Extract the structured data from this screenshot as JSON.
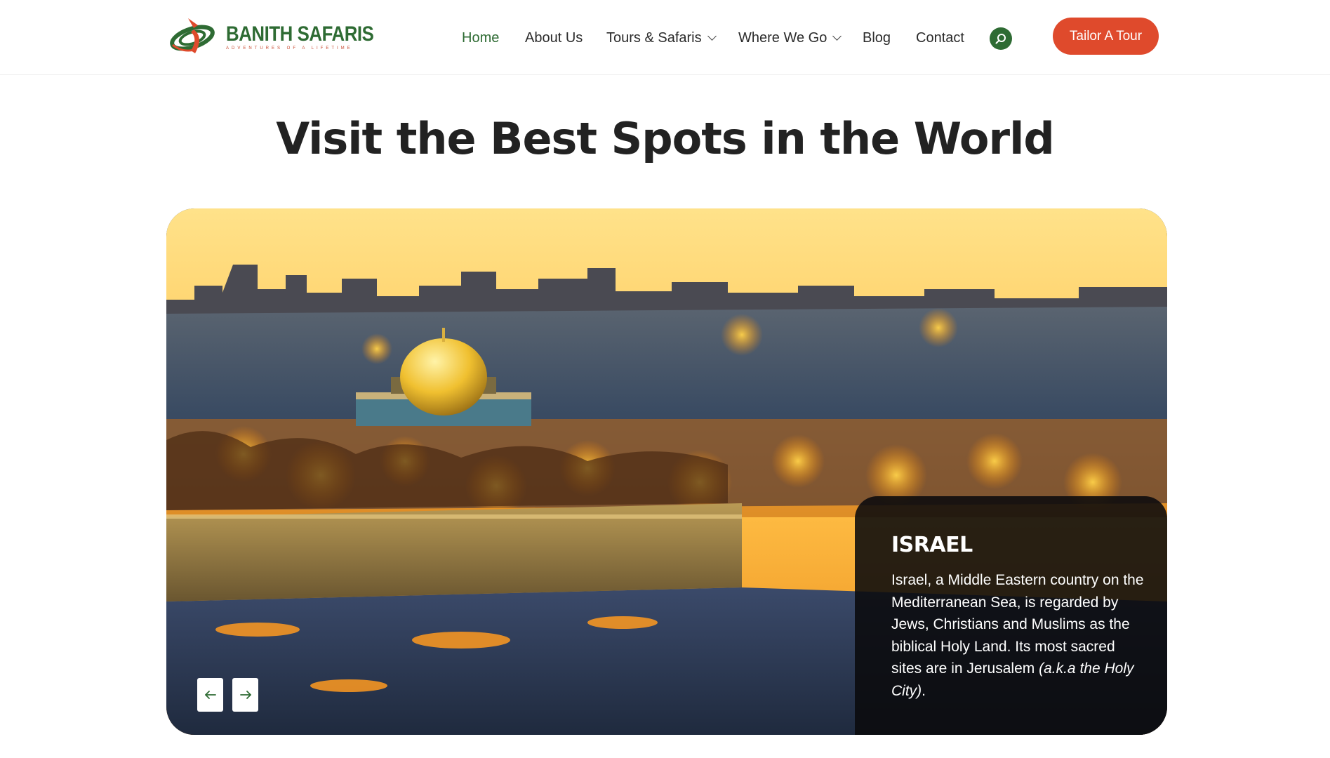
{
  "logo": {
    "name": "BANITH SAFARIS",
    "tagline": "ADVENTURES OF A LIFETIME"
  },
  "nav": {
    "items": [
      {
        "label": "Home",
        "active": true
      },
      {
        "label": "About Us"
      },
      {
        "label": "Tours & Safaris",
        "dropdown": true
      },
      {
        "label": "Where We Go",
        "dropdown": true
      },
      {
        "label": "Blog"
      },
      {
        "label": "Contact"
      }
    ],
    "search_icon": "search-icon",
    "cta_label": "Tailor A Tour"
  },
  "hero": {
    "title": "Visit the Best Spots in the World"
  },
  "slide": {
    "country": "ISRAEL",
    "description_plain": "Israel, a Middle Eastern country on the Mediterranean Sea, is regarded by Jews, Christians and Muslims as the biblical Holy Land. Its most sacred sites are in Jerusalem ",
    "description_italic": "(a.k.a the Holy City)",
    "description_end": ".",
    "image_subject": "jerusalem-skyline-dome-of-the-rock-image"
  },
  "controls": {
    "prev_icon": "arrow-left-icon",
    "next_icon": "arrow-right-icon"
  },
  "colors": {
    "brand_green": "#2e6b33",
    "cta_red": "#df4a2c",
    "title_text": "#222222"
  }
}
